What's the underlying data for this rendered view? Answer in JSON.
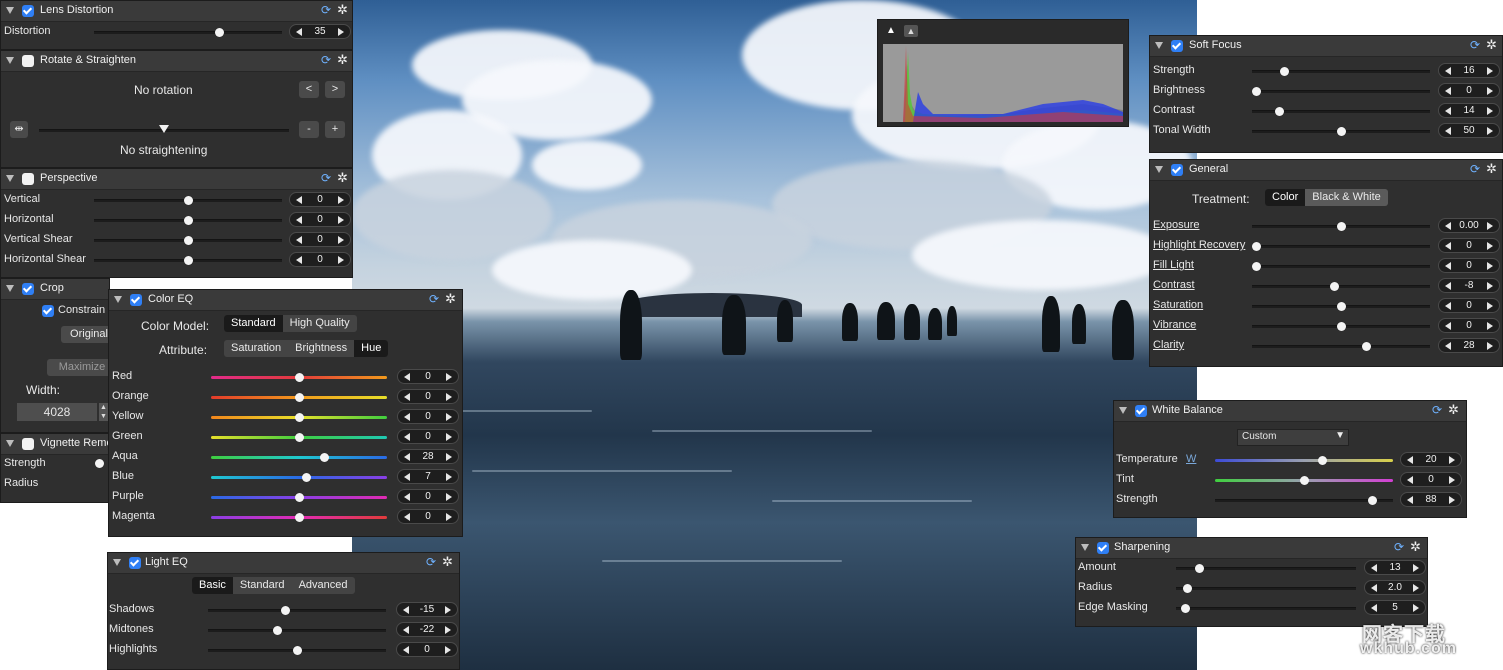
{
  "lens": {
    "title": "Lens Distortion",
    "rows": [
      {
        "label": "Distortion",
        "value": "35",
        "pos": 0.62
      }
    ]
  },
  "rotate": {
    "title": "Rotate & Straighten",
    "rotation": "No rotation",
    "straighten": "No straightening",
    "btn_left": "<",
    "btn_right": ">",
    "btn_minus": "-",
    "btn_plus": "+",
    "icon": "straighten-icon"
  },
  "perspective": {
    "title": "Perspective",
    "rows": [
      {
        "label": "Vertical",
        "value": "0",
        "pos": 0.5
      },
      {
        "label": "Horizontal",
        "value": "0",
        "pos": 0.5
      },
      {
        "label": "Vertical Shear",
        "value": "0",
        "pos": 0.5
      },
      {
        "label": "Horizontal Shear",
        "value": "0",
        "pos": 0.5
      }
    ]
  },
  "crop": {
    "title": "Crop",
    "constrain": "Constrain",
    "original": "Original",
    "maximize": "Maximize",
    "width_label": "Width:",
    "width_value": "4028"
  },
  "vignette": {
    "title": "Vignette Remo",
    "rows": [
      {
        "label": "Strength"
      },
      {
        "label": "Radius"
      }
    ]
  },
  "coloreq": {
    "title": "Color EQ",
    "model_label": "Color Model:",
    "model_options": [
      "Standard",
      "High Quality"
    ],
    "model_selected": 0,
    "attr_label": "Attribute:",
    "attr_options": [
      "Saturation",
      "Brightness",
      "Hue"
    ],
    "attr_selected": 2,
    "rows": [
      {
        "label": "Red",
        "value": "0",
        "pos": 0.5,
        "grad": "linear-gradient(90deg,#e22b8a,#e23b3b,#f29a1c)"
      },
      {
        "label": "Orange",
        "value": "0",
        "pos": 0.5,
        "grad": "linear-gradient(90deg,#e33b2b,#f29a1c,#e8e02a)"
      },
      {
        "label": "Yellow",
        "value": "0",
        "pos": 0.5,
        "grad": "linear-gradient(90deg,#f2861c,#e8e02a,#3fcf3f)"
      },
      {
        "label": "Green",
        "value": "0",
        "pos": 0.5,
        "grad": "linear-gradient(90deg,#e8e02a,#3fcf3f,#1fc9b3)"
      },
      {
        "label": "Aqua",
        "value": "28",
        "pos": 0.64,
        "grad": "linear-gradient(90deg,#3fcf3f,#1fc9d0,#2a6ae6)"
      },
      {
        "label": "Blue",
        "value": "7",
        "pos": 0.54,
        "grad": "linear-gradient(90deg,#1fc9d0,#2a6ae6,#8a3fe6)"
      },
      {
        "label": "Purple",
        "value": "0",
        "pos": 0.5,
        "grad": "linear-gradient(90deg,#2a6ae6,#8a3fe6,#e22bb3)"
      },
      {
        "label": "Magenta",
        "value": "0",
        "pos": 0.5,
        "grad": "linear-gradient(90deg,#8a3fe6,#e22bb3,#e23b3b)"
      }
    ]
  },
  "lighteq": {
    "title": "Light EQ",
    "modes": [
      "Basic",
      "Standard",
      "Advanced"
    ],
    "mode_selected": 0,
    "rows": [
      {
        "label": "Shadows",
        "value": "-15",
        "pos": 0.43
      },
      {
        "label": "Midtones",
        "value": "-22",
        "pos": 0.39
      },
      {
        "label": "Highlights",
        "value": "0",
        "pos": 0.5
      }
    ]
  },
  "softfocus": {
    "title": "Soft Focus",
    "rows": [
      {
        "label": "Strength",
        "value": "16",
        "pos": 0.18
      },
      {
        "label": "Brightness",
        "value": "0",
        "pos": 0.02
      },
      {
        "label": "Contrast",
        "value": "14",
        "pos": 0.15
      },
      {
        "label": "Tonal Width",
        "value": "50",
        "pos": 0.5
      }
    ]
  },
  "general": {
    "title": "General",
    "treatment_label": "Treatment:",
    "treatments": [
      "Color",
      "Black & White"
    ],
    "treatment_selected": 0,
    "rows": [
      {
        "label": "Exposure",
        "value": "0.00",
        "pos": 0.5
      },
      {
        "label": "Highlight Recovery",
        "value": "0",
        "pos": 0.02
      },
      {
        "label": "Fill Light",
        "value": "0",
        "pos": 0.02
      },
      {
        "label": "Contrast",
        "value": "-8",
        "pos": 0.46
      },
      {
        "label": "Saturation",
        "value": "0",
        "pos": 0.5
      },
      {
        "label": "Vibrance",
        "value": "0",
        "pos": 0.5
      },
      {
        "label": "Clarity",
        "value": "28",
        "pos": 0.64
      }
    ]
  },
  "whitebalance": {
    "title": "White Balance",
    "preset": "Custom",
    "rows": [
      {
        "label": "Temperature",
        "value": "20",
        "pos": 0.6,
        "grad": "linear-gradient(90deg,#3c4bd6,#9aa0b0,#d8d04a)",
        "suffix": "W"
      },
      {
        "label": "Tint",
        "value": "0",
        "pos": 0.5,
        "grad": "linear-gradient(90deg,#3fcf3f,#9aa0b0,#d33fd3)"
      },
      {
        "label": "Strength",
        "value": "88",
        "pos": 0.88
      }
    ]
  },
  "sharpening": {
    "title": "Sharpening",
    "rows": [
      {
        "label": "Amount",
        "value": "13",
        "pos": 0.13
      },
      {
        "label": "Radius",
        "value": "2.0",
        "pos": 0.06
      },
      {
        "label": "Edge Masking",
        "value": "5",
        "pos": 0.05
      }
    ]
  },
  "histogram": {
    "modes": [
      "luminance-icon",
      "rgb-icon"
    ]
  },
  "watermark": {
    "line1": "网客下载",
    "line2": "wkhub.com"
  }
}
